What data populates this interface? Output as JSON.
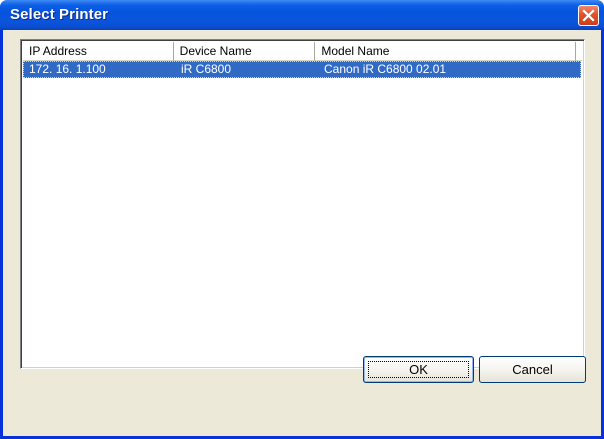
{
  "window": {
    "title": "Select Printer"
  },
  "listview": {
    "columns": [
      "IP Address",
      "Device Name",
      "Model Name"
    ],
    "rows": [
      {
        "ip": "172. 16.  1.100",
        "device": "iR C6800",
        "model": "Canon iR C6800 02.01",
        "selected": true
      }
    ]
  },
  "buttons": {
    "ok_label": "OK",
    "cancel_label": "Cancel"
  },
  "colors": {
    "titlebar": "#0054e3",
    "selection": "#316ac5",
    "dialog_face": "#ece9d8",
    "close_button": "#e0512c"
  },
  "icons": {
    "close": "close-icon"
  }
}
